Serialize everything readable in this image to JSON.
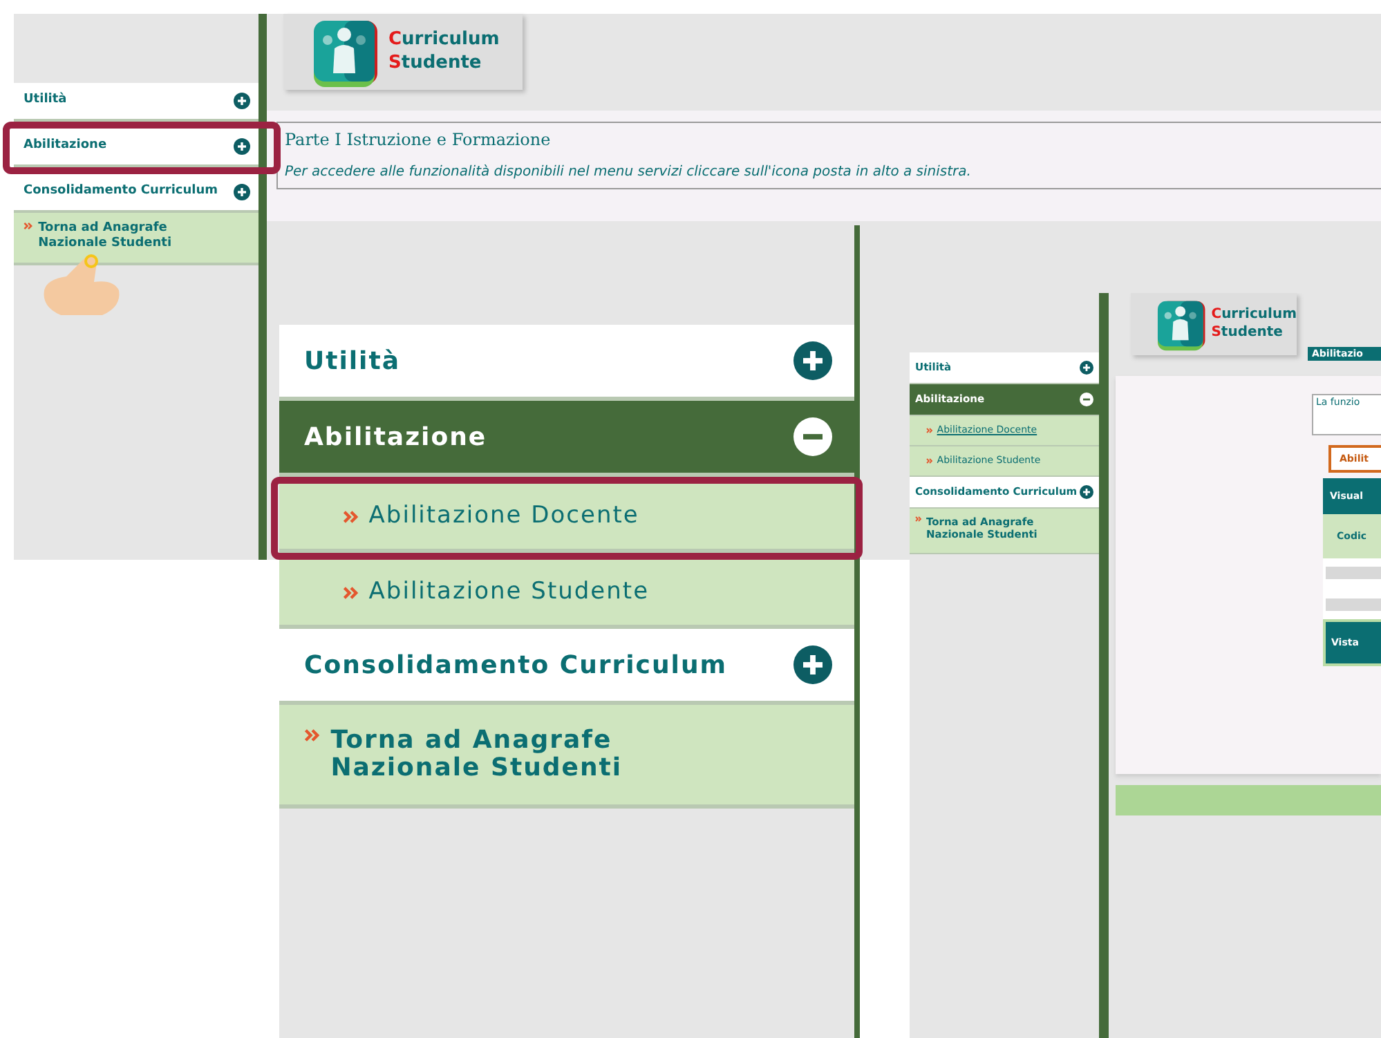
{
  "overview_screen": {
    "logo": [
      "Curriculum",
      "Studente"
    ],
    "menu": [
      {
        "label": "Utilità",
        "kind": "section",
        "expanded": false,
        "highlighted": false
      },
      {
        "label": "Abilitazione",
        "kind": "section",
        "expanded": false,
        "highlighted": true
      },
      {
        "label": "Consolidamento Curriculum",
        "kind": "section",
        "expanded": false,
        "highlighted": false
      },
      {
        "label": "Torna ad Anagrafe Nazionale Studenti",
        "kind": "link",
        "highlighted": false
      }
    ],
    "title": "Parte I Istruzione e Formazione",
    "notice": "Per accedere alle funzionalità disponibili nel menu servizi cliccare sull'icona posta in alto a sinistra."
  },
  "zoomed_menu": {
    "menu": [
      {
        "label": "Utilità",
        "kind": "section",
        "expanded": false,
        "highlighted": false
      },
      {
        "label": "Abilitazione",
        "kind": "section",
        "expanded": true,
        "highlighted": false
      },
      {
        "label": "Abilitazione Docente",
        "kind": "subitem",
        "highlighted": true
      },
      {
        "label": "Abilitazione Studente",
        "kind": "subitem",
        "highlighted": false
      },
      {
        "label": "Consolidamento Curriculum",
        "kind": "section",
        "expanded": false,
        "highlighted": false
      },
      {
        "label": "Torna ad Anagrafe Nazionale Studenti",
        "kind": "link",
        "highlighted": false
      }
    ]
  },
  "result_screen": {
    "logo": [
      "Curriculum",
      "Studente"
    ],
    "breadcrumb": "Abilitazio",
    "menu": [
      {
        "label": "Utilità",
        "kind": "section",
        "expanded": false,
        "selected": false
      },
      {
        "label": "Abilitazione",
        "kind": "section",
        "expanded": true,
        "selected": false
      },
      {
        "label": "Abilitazione Docente",
        "kind": "subitem",
        "selected": true
      },
      {
        "label": "Abilitazione Studente",
        "kind": "subitem",
        "selected": false
      },
      {
        "label": "Consolidamento Curriculum",
        "kind": "section",
        "expanded": false,
        "selected": false
      },
      {
        "label": "Torna ad Anagrafe Nazionale Studenti",
        "kind": "link",
        "selected": false
      }
    ],
    "notice": "La funzio",
    "tab": "Abilit",
    "table_header": "Visual",
    "row_label": "Codic",
    "footer_button": "Vista"
  }
}
